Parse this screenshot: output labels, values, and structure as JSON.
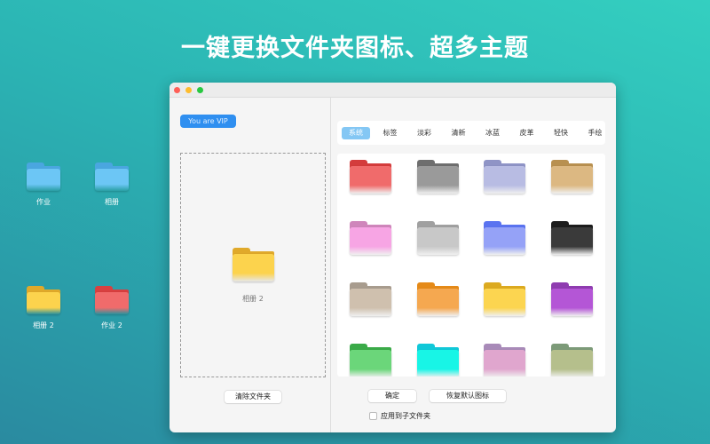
{
  "headline": "一键更换文件夹图标、超多主题",
  "desktop": [
    {
      "label": "作业",
      "color": "#6cc6f5",
      "tab": "#4aa6e0"
    },
    {
      "label": "相册",
      "color": "#6cc6f5",
      "tab": "#4aa6e0"
    },
    {
      "label": "相册 2",
      "color": "#fcd34d",
      "tab": "#e0a92a"
    },
    {
      "label": "作业 2",
      "color": "#f06b6b",
      "tab": "#d84040"
    }
  ],
  "window": {
    "vip_badge": "You are VIP",
    "drop_folder_label": "相册 2",
    "drop_folder_color": "#fcd34d",
    "clear_button": "清除文件夹",
    "tabs": [
      "系统",
      "标签",
      "淡彩",
      "清新",
      "冰蓝",
      "皮革",
      "轻快",
      "手绘"
    ],
    "active_tab": 0,
    "folders": [
      {
        "color": "#f06b6b",
        "tab": "#d43c3c"
      },
      {
        "color": "#9a9a9a",
        "tab": "#6e6e6e"
      },
      {
        "color": "#b8bce3",
        "tab": "#8f94c6"
      },
      {
        "color": "#dcb882",
        "tab": "#b89050"
      },
      {
        "color": "#f7a5e4",
        "tab": "#cf86bb"
      },
      {
        "color": "#c8c8c8",
        "tab": "#a0a0a0"
      },
      {
        "color": "#95a2f7",
        "tab": "#5a73f0"
      },
      {
        "color": "#3a3a3a",
        "tab": "#1c1c1c"
      },
      {
        "color": "#cfc0ae",
        "tab": "#a89c8e"
      },
      {
        "color": "#f5a850",
        "tab": "#e58a18"
      },
      {
        "color": "#fcd550",
        "tab": "#dcaa20"
      },
      {
        "color": "#b456d6",
        "tab": "#8f3cb0"
      },
      {
        "color": "#6bd67a",
        "tab": "#3aaa48"
      },
      {
        "color": "#18f5e6",
        "tab": "#10c8d8"
      },
      {
        "color": "#e0a6ce",
        "tab": "#a88ab8"
      },
      {
        "color": "#b5bf8c",
        "tab": "#7c9a78"
      }
    ],
    "ok_button": "确定",
    "restore_button": "恢复默认图标",
    "apply_subfolders_label": "应用到子文件夹",
    "apply_subfolders_checked": false
  }
}
